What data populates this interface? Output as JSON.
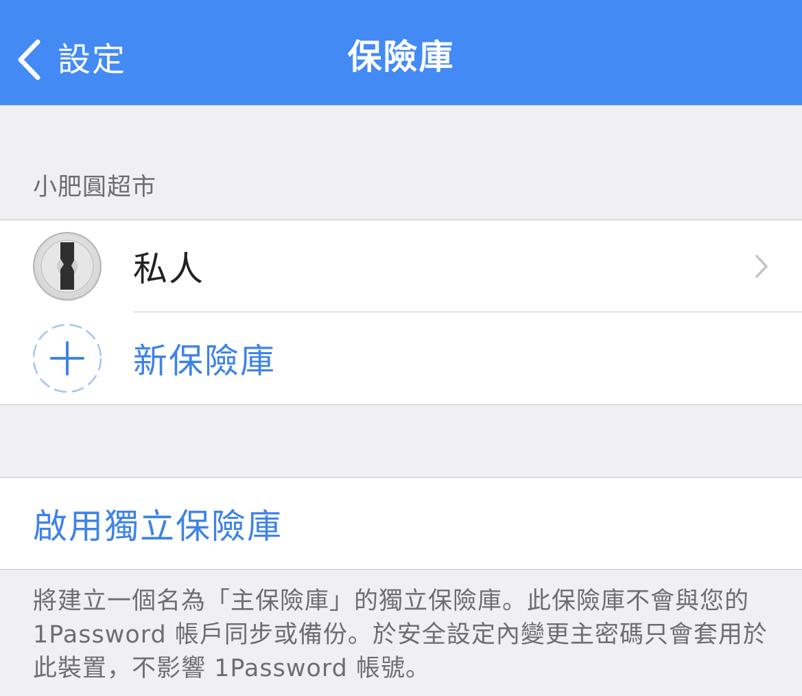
{
  "navbar": {
    "back_label": "設定",
    "title": "保險庫",
    "background_color": "#438af4"
  },
  "section": {
    "header": "小肥圓超市",
    "items": [
      {
        "label": "私人",
        "icon": "1password-keyhole-icon"
      }
    ],
    "add_label": "新保險庫",
    "add_icon": "plus-dashed-circle-icon"
  },
  "standalone": {
    "action_label": "啟用獨立保險庫",
    "footer": "將建立一個名為「主保險庫」的獨立保險庫。此保險庫不會與您的 1Password 帳戶同步或備份。於安全設定內變更主密碼只會套用於此裝置，不影響 1Password 帳號。"
  },
  "colors": {
    "accent": "#3f83e6",
    "grouped_background": "#efeff4",
    "secondary_text": "#6d6d72"
  }
}
